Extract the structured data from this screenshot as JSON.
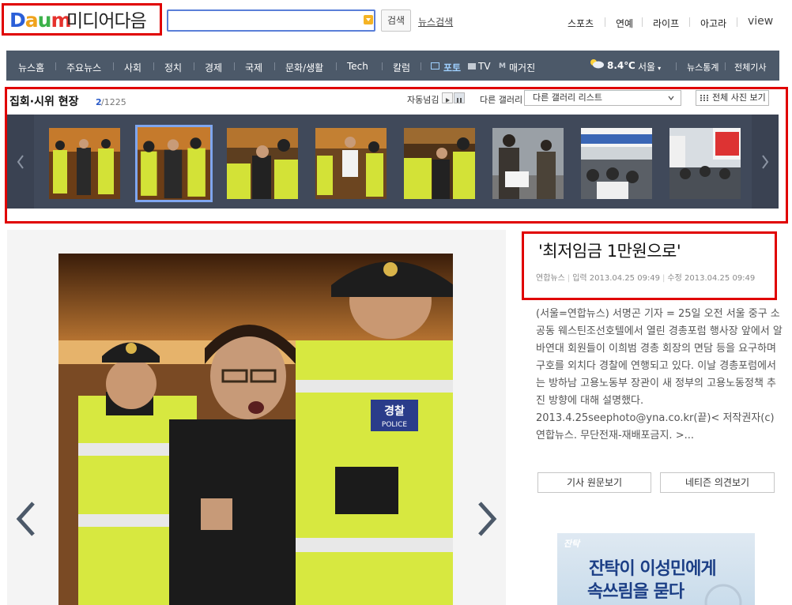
{
  "header": {
    "logo_daum": "Daum",
    "logo_media": "미디어다음",
    "search_placeholder": "",
    "search_button": "검색",
    "news_search_link": "뉴스검색",
    "top_links": [
      "스포츠",
      "연예",
      "라이프",
      "아고라",
      "view"
    ]
  },
  "nav": {
    "items": [
      "뉴스홈",
      "주요뉴스",
      "사회",
      "정치",
      "경제",
      "국제",
      "문화/생활",
      "Tech",
      "칼럼",
      "포토",
      "TV",
      "매거진"
    ],
    "weather_temp": "8.4℃",
    "weather_city": "서울",
    "news_stats": "뉴스통계",
    "all_articles": "전체기사"
  },
  "gallery": {
    "title": "집회·시위 현장",
    "current": "2",
    "total": "/1225",
    "autoplay_label": "자동넘김",
    "other_gallery_label": "다른 갤러리",
    "select_value": "다른 갤러리 리스트",
    "view_all": "전체 사진 보기",
    "active_index": 1
  },
  "article": {
    "title": "'최저임금 1만원으로'",
    "source": "연합뉴스",
    "input_label": "입력",
    "input_time": "2013.04.25 09:49",
    "modified_label": "수정",
    "modified_time": "2013.04.25 09:49",
    "body": "(서울=연합뉴스) 서명곤 기자 = 25일 오전 서울 중구 소공동 웨스틴조선호텔에서 열린 경총포럼 행사장 앞에서 알바연대 회원들이 이희범 경총 회장의 면담 등을 요구하며 구호를 외치다 경찰에 연행되고 있다. 이날 경총포럼에서는 방하남 고용노동부 장관이 새 정부의 고용노동정책 추진 방향에 대해 설명했다. 2013.4.25seephoto@yna.co.kr(끝)< 저작권자(c)연합뉴스. 무단전재-재배포금지. >...",
    "btn_original": "기사 원문보기",
    "btn_comments": "네티즌 의견보기"
  },
  "photo": {
    "vest_label": "경찰",
    "vest_sub": "POLICE"
  },
  "ad": {
    "brand": "잔탁",
    "line1": "잔탁이 이성민에게",
    "line2": "속쓰림을 묻다"
  },
  "colors": {
    "brand_red": "#e00000",
    "nav_bg": "#4c5969",
    "strip_bg": "#40495a",
    "active_thumb": "#7fa6ef",
    "police_yellow": "#d7e840"
  }
}
